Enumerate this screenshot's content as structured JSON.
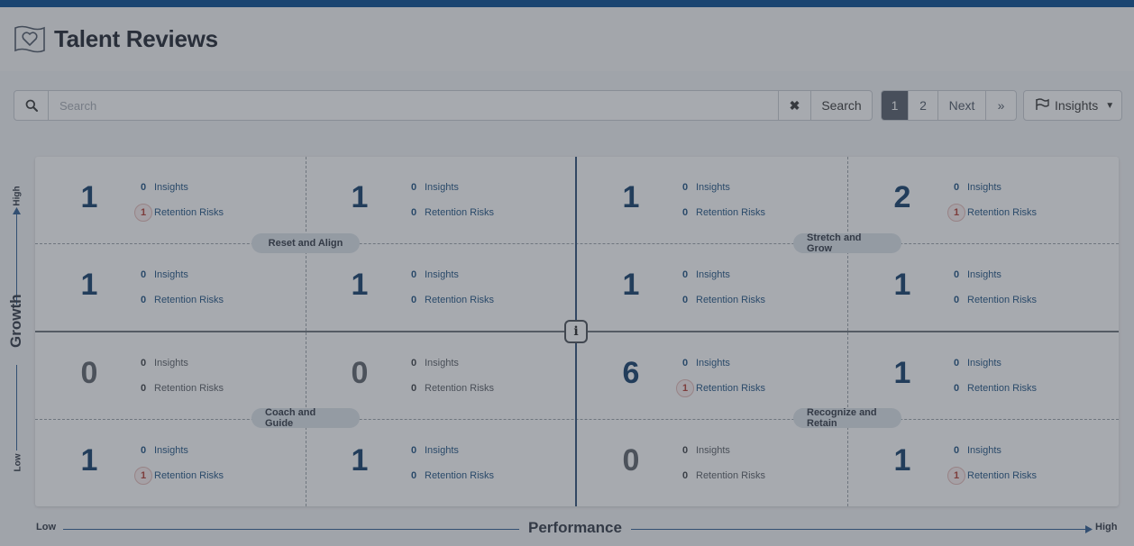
{
  "header": {
    "title": "Talent Reviews",
    "logo_icon": "heart-flag-icon"
  },
  "search": {
    "placeholder": "Search",
    "button_label": "Search",
    "search_icon": "search-icon",
    "clear_icon": "close-icon"
  },
  "pagination": {
    "pages": [
      "1",
      "2"
    ],
    "active_page": "1",
    "next_label": "Next",
    "last_label": "»"
  },
  "insights_dropdown": {
    "label": "Insights",
    "icon": "flag-icon"
  },
  "labels": {
    "insights": "Insights",
    "retention_risks": "Retention Risks"
  },
  "quadrants": {
    "top_left": "Reset and Align",
    "top_right": "Stretch and Grow",
    "bottom_left": "Coach and Guide",
    "bottom_right": "Recognize and Retain"
  },
  "axes": {
    "y_title": "Growth",
    "y_high": "High",
    "y_low": "Low",
    "x_title": "Performance",
    "x_low": "Low",
    "x_high": "High"
  },
  "info_icon": "info-icon",
  "cells": [
    [
      {
        "count": "1",
        "insights": "0",
        "risks": "1"
      },
      {
        "count": "1",
        "insights": "0",
        "risks": "0"
      },
      {
        "count": "1",
        "insights": "0",
        "risks": "0"
      },
      {
        "count": "2",
        "insights": "0",
        "risks": "1"
      }
    ],
    [
      {
        "count": "1",
        "insights": "0",
        "risks": "0"
      },
      {
        "count": "1",
        "insights": "0",
        "risks": "0"
      },
      {
        "count": "1",
        "insights": "0",
        "risks": "0"
      },
      {
        "count": "1",
        "insights": "0",
        "risks": "0"
      }
    ],
    [
      {
        "count": "0",
        "insights": "0",
        "risks": "0"
      },
      {
        "count": "0",
        "insights": "0",
        "risks": "0"
      },
      {
        "count": "6",
        "insights": "0",
        "risks": "1"
      },
      {
        "count": "1",
        "insights": "0",
        "risks": "0"
      }
    ],
    [
      {
        "count": "1",
        "insights": "0",
        "risks": "1"
      },
      {
        "count": "1",
        "insights": "0",
        "risks": "0"
      },
      {
        "count": "0",
        "insights": "0",
        "risks": "0"
      },
      {
        "count": "1",
        "insights": "0",
        "risks": "1"
      }
    ]
  ],
  "colors": {
    "brand": "#00488f",
    "count": "#0d3a66",
    "link": "#1b4f80",
    "risk_badge": "#b33a2e"
  }
}
